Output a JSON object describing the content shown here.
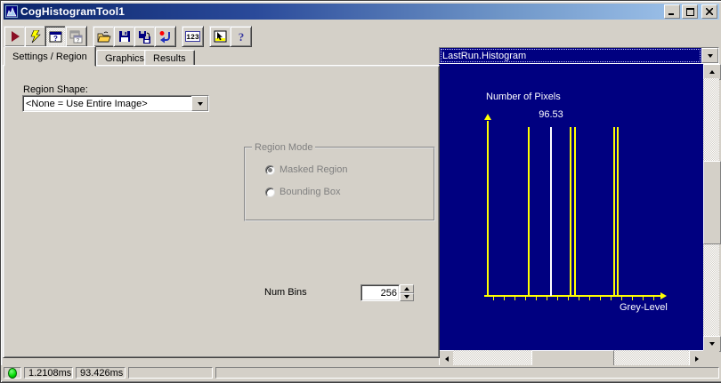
{
  "window": {
    "title": "CogHistogramTool1",
    "app_icon": "histogram-icon",
    "controls": [
      {
        "name": "minimize",
        "icon": "minimize-icon"
      },
      {
        "name": "maximize",
        "icon": "maximize-icon"
      },
      {
        "name": "close",
        "icon": "close-icon"
      }
    ]
  },
  "toolbar": {
    "buttons": [
      {
        "name": "run",
        "icon": "run-icon",
        "pressed": false,
        "disabled": false
      },
      {
        "name": "electric-run",
        "icon": "lightning-icon",
        "pressed": false,
        "disabled": false
      },
      {
        "name": "tool-display",
        "icon": "window-question-icon",
        "pressed": true,
        "disabled": false
      },
      {
        "name": "floating-tool-display",
        "icon": "floating-window-question-icon",
        "pressed": false,
        "disabled": true
      },
      {
        "name": "open",
        "icon": "open-folder-icon",
        "pressed": false,
        "disabled": false
      },
      {
        "name": "save",
        "icon": "floppy-disk-icon",
        "pressed": false,
        "disabled": false
      },
      {
        "name": "save-as",
        "icon": "floppy-save-as-icon",
        "pressed": false,
        "disabled": false
      },
      {
        "name": "reset",
        "icon": "reset-arrow-icon",
        "pressed": false,
        "disabled": false
      },
      {
        "name": "numeric-display",
        "icon": "numeric-123-icon",
        "pressed": false,
        "disabled": false
      },
      {
        "name": "tool-window",
        "icon": "window-cursor-icon",
        "pressed": false,
        "disabled": false
      },
      {
        "name": "help",
        "icon": "question-mark-icon",
        "pressed": false,
        "disabled": false
      }
    ]
  },
  "tabs": [
    {
      "label": "Settings / Region",
      "active": true
    },
    {
      "label": "Graphics",
      "active": false
    },
    {
      "label": "Results",
      "active": false
    }
  ],
  "settings_tab": {
    "region_shape": {
      "label": "Region Shape:",
      "value": "<None = Use Entire Image>"
    },
    "region_mode": {
      "legend": "Region Mode",
      "disabled": true,
      "options": [
        {
          "label": "Masked Region",
          "selected": true
        },
        {
          "label": "Bounding Box",
          "selected": false
        }
      ]
    },
    "num_bins": {
      "label": "Num Bins",
      "value": "256"
    }
  },
  "results_panel": {
    "selector_value": "LastRun.Histogram"
  },
  "chart_data": {
    "type": "bar",
    "title": "LastRun.Histogram",
    "ylabel": "Number of Pixels",
    "xlabel": "Grey-Level",
    "background_color": "#000080",
    "axis_color": "#ffff00",
    "bar_color": "#ffff00",
    "highlight_color": "#ffffff",
    "grid": false,
    "y_axis_ticks_labeled": false,
    "x_axis_ticks_labeled": false,
    "x_tick_count": 16,
    "annotation": {
      "text": "96.53",
      "bar_index": 1
    },
    "bars": [
      {
        "x_frac": 0.233,
        "height_frac": 1.0,
        "highlight": false
      },
      {
        "x_frac": 0.363,
        "height_frac": 1.0,
        "highlight": true
      },
      {
        "x_frac": 0.477,
        "height_frac": 1.0,
        "highlight": false
      },
      {
        "x_frac": 0.5,
        "height_frac": 1.0,
        "highlight": false
      },
      {
        "x_frac": 0.731,
        "height_frac": 1.0,
        "highlight": false
      },
      {
        "x_frac": 0.752,
        "height_frac": 1.0,
        "highlight": false
      }
    ]
  },
  "statusbar": {
    "led_color": "#00d800",
    "cells": [
      {
        "text": "1.2108ms"
      },
      {
        "text": "93.426ms"
      },
      {
        "text": ""
      },
      {
        "text": ""
      }
    ]
  }
}
